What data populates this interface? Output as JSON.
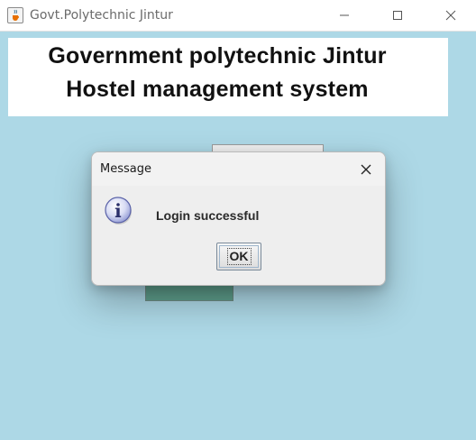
{
  "window": {
    "title": "Govt.Polytechnic Jintur",
    "icon": "java-cup-icon",
    "controls": [
      "minimize-icon",
      "maximize-icon",
      "close-icon"
    ]
  },
  "banner": {
    "line1": "Government polytechnic Jintur",
    "line2": "Hostel management system"
  },
  "dialog": {
    "title": "Message",
    "icon": "info-icon",
    "message": "Login successful",
    "ok_label": "OK"
  },
  "colors": {
    "background": "#add8e6",
    "button_green": "#5e9e8c",
    "dialog_bg": "#eeeeee"
  }
}
